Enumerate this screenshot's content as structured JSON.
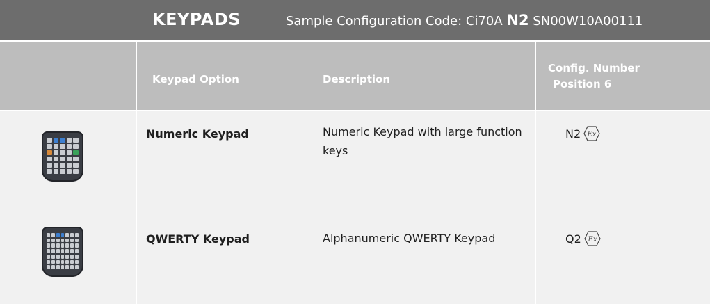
{
  "header": {
    "title": "KEYPADS",
    "sample_prefix": "Sample Configuration Code: Ci70A ",
    "sample_code": "N2",
    "sample_suffix": " SN00W10A00111"
  },
  "columns": {
    "option": "Keypad Option",
    "description": "Description",
    "config_line1": "Config. Number",
    "config_line2": "Position 6"
  },
  "rows": [
    {
      "image_icon": "numeric-keypad-image",
      "option": "Numeric Keypad",
      "description": "Numeric Keypad with large function keys",
      "code": "N2",
      "cert_icon": "ex-hexagon-icon"
    },
    {
      "image_icon": "qwerty-keypad-image",
      "option": "QWERTY Keypad",
      "description": "Alphanumeric QWERTY Keypad",
      "code": "Q2",
      "cert_icon": "ex-hexagon-icon"
    }
  ],
  "colors": {
    "title_bar": "#6d6d6d",
    "header_row": "#bdbdbd",
    "body_row": "#f1f1f1"
  }
}
